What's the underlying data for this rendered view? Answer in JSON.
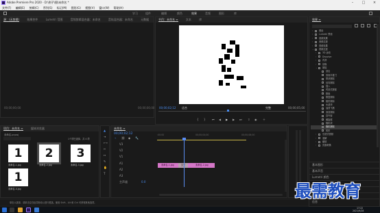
{
  "titlebar": {
    "title": "Adobe Premiere Pro 2020 - D:\\例子\\图\\未命名 *"
  },
  "menubar": {
    "items": [
      "文件(F)",
      "编辑(E)",
      "剪辑(C)",
      "序列(S)",
      "标记(M)",
      "图形(G)",
      "视图(V)",
      "窗口(W)",
      "帮助(H)"
    ]
  },
  "workspaces": {
    "items": [
      "学习",
      "组件",
      "编辑",
      "颜色",
      "效果",
      "音频",
      "图形",
      "库"
    ],
    "active": "效果"
  },
  "source_panel": {
    "tabs": [
      "源：(无剪辑)",
      "效果控件",
      "Lumetri 范围",
      "音频剪辑混合器：未命名",
      "音轨混合器：未命名",
      "元数据"
    ],
    "tc_left": "00;00;00;00",
    "tc_right": "00;00;00;00"
  },
  "program_panel": {
    "tabs": [
      "节目：未命名 ≡",
      "文本",
      "库"
    ],
    "tc_left": "00;00;02;12",
    "fit": "适合",
    "quality": "完整",
    "tc_right": "00;00;05;00"
  },
  "project_panel": {
    "tabs": [
      "项目：未命名 ≡",
      "媒体浏览器"
    ],
    "path": "未命名.prproj",
    "search_placeholder": "",
    "count": "1个项已选择，共 4 项",
    "items": [
      {
        "glyph": "1",
        "label": "未命名-1.jpg"
      },
      {
        "glyph": "2",
        "label": "未命名-2.jpg"
      },
      {
        "glyph": "3",
        "label": "未命名-3.jpg"
      },
      {
        "glyph": "1",
        "label": "未命名-4.jpg"
      }
    ]
  },
  "timeline": {
    "tab": "未命名 ≡",
    "timecode": "00;00;02;12",
    "ruler": [
      ":00:00",
      "00;00;04;00",
      "00;00;08;00"
    ],
    "tracks": [
      "V3",
      "V2",
      "V1",
      "A1",
      "A2",
      "A3",
      "主声道"
    ],
    "master_value": "0.0",
    "clips": [
      {
        "label": "未命名-1.jpg"
      },
      {
        "label": "未命名-2.jpg"
      }
    ],
    "transition_label": "交叉"
  },
  "effects_panel": {
    "title": "效果 ≡",
    "rows": [
      {
        "text": "预设",
        "indent": 0,
        "arrow": "›"
      },
      {
        "text": "Lumetri 预设",
        "indent": 0,
        "arrow": "›"
      },
      {
        "text": "音频效果",
        "indent": 0,
        "arrow": "›"
      },
      {
        "text": "音频过渡",
        "indent": 0,
        "arrow": "›"
      },
      {
        "text": "视频效果",
        "indent": 0,
        "arrow": "›"
      },
      {
        "text": "视频过渡",
        "indent": 0,
        "arrow": "⌄"
      },
      {
        "text": "3D 运动",
        "indent": 1,
        "arrow": "›"
      },
      {
        "text": "Dissolve",
        "indent": 1,
        "arrow": "›"
      },
      {
        "text": "内滑",
        "indent": 1,
        "arrow": "›"
      },
      {
        "text": "划像",
        "indent": 1,
        "arrow": "›"
      },
      {
        "text": "擦除",
        "indent": 1,
        "arrow": "⌄"
      },
      {
        "text": "划出",
        "indent": 2,
        "arrow": ""
      },
      {
        "text": "双侧平推门",
        "indent": 2,
        "arrow": ""
      },
      {
        "text": "带状擦除",
        "indent": 2,
        "arrow": ""
      },
      {
        "text": "径向擦除",
        "indent": 2,
        "arrow": ""
      },
      {
        "text": "插入",
        "indent": 2,
        "arrow": ""
      },
      {
        "text": "时钟式擦除",
        "indent": 2,
        "arrow": ""
      },
      {
        "text": "棋盘",
        "indent": 2,
        "arrow": ""
      },
      {
        "text": "棋盘擦除",
        "indent": 2,
        "arrow": ""
      },
      {
        "text": "楔形擦除",
        "indent": 2,
        "arrow": ""
      },
      {
        "text": "水波块",
        "indent": 2,
        "arrow": ""
      },
      {
        "text": "油漆飞溅",
        "indent": 2,
        "arrow": ""
      },
      {
        "text": "渐变擦除",
        "indent": 2,
        "arrow": ""
      },
      {
        "text": "百叶窗",
        "indent": 2,
        "arrow": ""
      },
      {
        "text": "螺旋框",
        "indent": 2,
        "arrow": ""
      },
      {
        "text": "随机块",
        "indent": 2,
        "arrow": ""
      },
      {
        "text": "随机擦除",
        "indent": 2,
        "arrow": "",
        "selected": true
      },
      {
        "text": "风车",
        "indent": 2,
        "arrow": ""
      },
      {
        "text": "沉浸式视频",
        "indent": 1,
        "arrow": "›"
      },
      {
        "text": "溶解",
        "indent": 1,
        "arrow": "›"
      },
      {
        "text": "缩放",
        "indent": 1,
        "arrow": "›"
      },
      {
        "text": "页面剥落",
        "indent": 1,
        "arrow": "›"
      }
    ],
    "sections": [
      "基本图形",
      "基本声音",
      "Lumetri 颜色",
      "库",
      "标记",
      "历史记录",
      "信息"
    ]
  },
  "statusbar": {
    "text": "单击以选择，或单击空白处并拖动以进行框选。使用 Shift、Alt 和 Ctrl 可获得其他选项。"
  },
  "watermark": {
    "text": "最需教育"
  },
  "taskbar": {
    "time": "17:22",
    "date": "2021/9/28"
  },
  "colors": {
    "accent": "#4a8df0",
    "clip": "#d577c8",
    "playhead": "#5b8df2",
    "workarea": "#c9b648"
  }
}
